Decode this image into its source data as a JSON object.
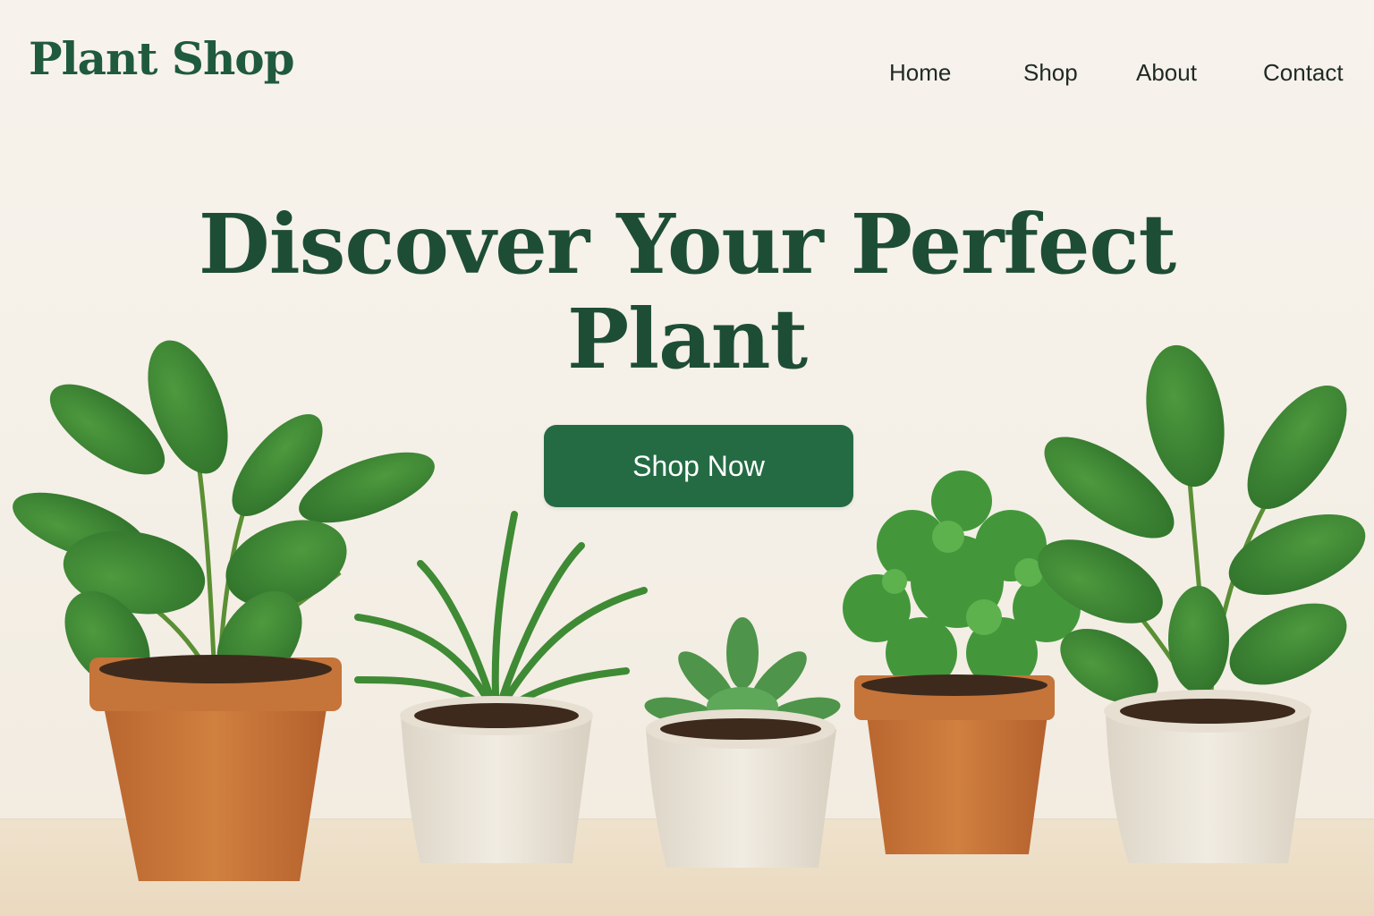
{
  "brand": {
    "name": "Plant Shop"
  },
  "nav": {
    "items": [
      "Home",
      "Shop",
      "About",
      "Contact"
    ]
  },
  "hero": {
    "title_line1": "Discover Your Perfect",
    "title_line2": "Plant",
    "cta_label": "Shop Now"
  },
  "colors": {
    "brand_green": "#1f5a3c",
    "button_green": "#246b44",
    "terracotta": "#c9773d",
    "cream_pot": "#ece6da"
  },
  "illustration": {
    "plants": [
      "fiddle-leaf-plant",
      "spider-plant",
      "succulent",
      "leafy-shrub",
      "rubber-plant"
    ]
  }
}
